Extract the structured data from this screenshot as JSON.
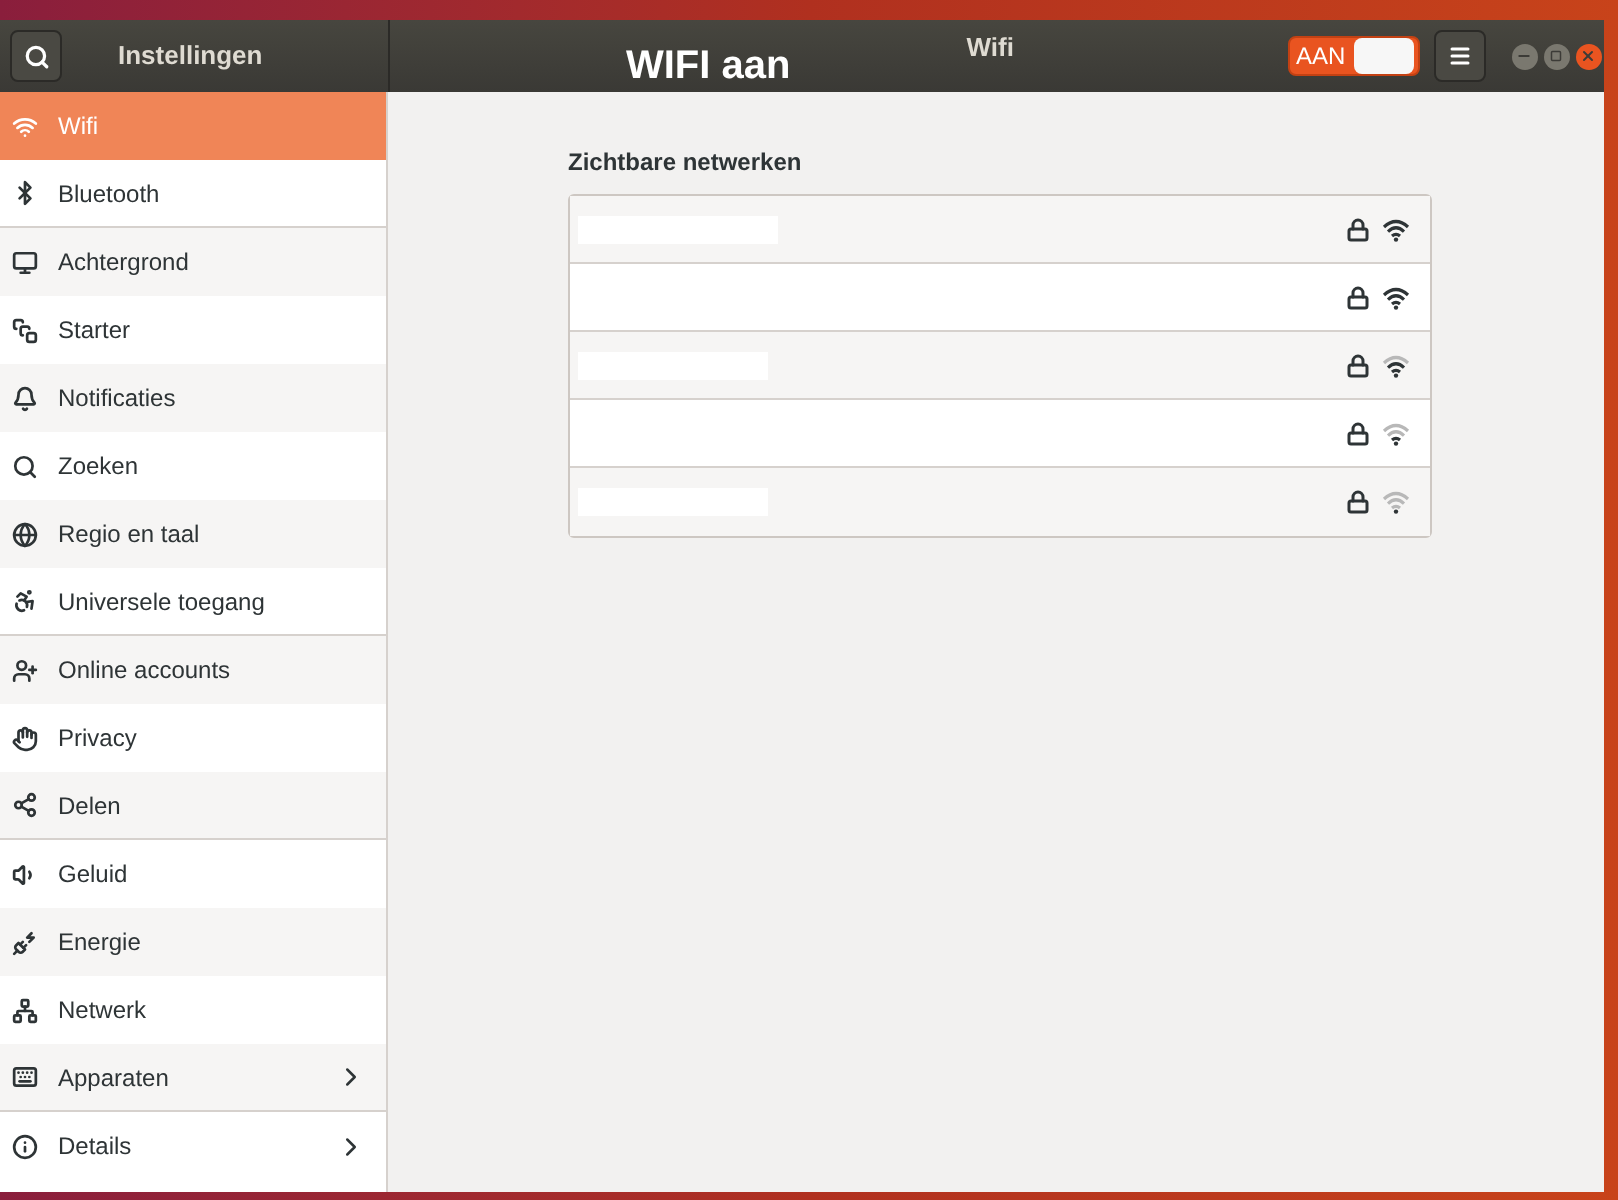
{
  "header": {
    "search_selected": false,
    "app_title": "Instellingen",
    "annotation": "WIFI aan",
    "page_title": "Wifi",
    "switch": {
      "label": "AAN",
      "on": true
    }
  },
  "sidebar": {
    "items": [
      {
        "label": "Wifi",
        "selected": true,
        "divider_after": false,
        "expandable": false
      },
      {
        "label": "Bluetooth",
        "selected": false,
        "divider_after": true,
        "expandable": false
      },
      {
        "label": "Achtergrond",
        "selected": false,
        "divider_after": false,
        "expandable": false
      },
      {
        "label": "Starter",
        "selected": false,
        "divider_after": false,
        "expandable": false
      },
      {
        "label": "Notificaties",
        "selected": false,
        "divider_after": false,
        "expandable": false
      },
      {
        "label": "Zoeken",
        "selected": false,
        "divider_after": false,
        "expandable": false
      },
      {
        "label": "Regio en taal",
        "selected": false,
        "divider_after": false,
        "expandable": false
      },
      {
        "label": "Universele toegang",
        "selected": false,
        "divider_after": true,
        "expandable": false
      },
      {
        "label": "Online accounts",
        "selected": false,
        "divider_after": false,
        "expandable": false
      },
      {
        "label": "Privacy",
        "selected": false,
        "divider_after": false,
        "expandable": false
      },
      {
        "label": "Delen",
        "selected": false,
        "divider_after": true,
        "expandable": false
      },
      {
        "label": "Geluid",
        "selected": false,
        "divider_after": false,
        "expandable": false
      },
      {
        "label": "Energie",
        "selected": false,
        "divider_after": false,
        "expandable": false
      },
      {
        "label": "Netwerk",
        "selected": false,
        "divider_after": false,
        "expandable": false
      },
      {
        "label": "Apparaten",
        "selected": false,
        "divider_after": true,
        "expandable": true
      },
      {
        "label": "Details",
        "selected": false,
        "divider_after": false,
        "expandable": true
      }
    ]
  },
  "networks": {
    "title": "Zichtbare netwerken",
    "rows": [
      {
        "secured": true,
        "kind": "strong"
      },
      {
        "secured": true,
        "kind": "strong"
      },
      {
        "secured": true,
        "kind": "good"
      },
      {
        "secured": true,
        "kind": "ok"
      },
      {
        "secured": true,
        "kind": "weak"
      }
    ]
  }
}
